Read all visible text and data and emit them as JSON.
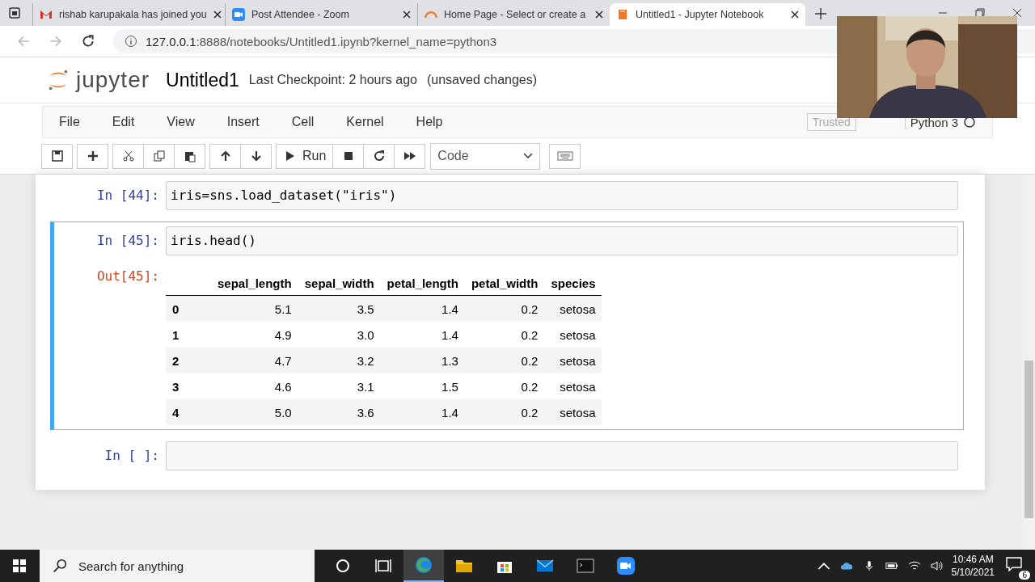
{
  "browser": {
    "tabs": [
      {
        "kind": "gmail",
        "title": "rishab karupakala has joined you",
        "selected": false
      },
      {
        "kind": "zoom",
        "title": "Post Attendee - Zoom",
        "selected": false
      },
      {
        "kind": "loader",
        "title": "Home Page - Select or create a",
        "selected": false
      },
      {
        "kind": "jupyter",
        "title": "Untitled1 - Jupyter Notebook",
        "selected": true
      }
    ],
    "url_host": "127.0.0.1",
    "url_rest": ":8888/notebooks/Untitled1.ipynb?kernel_name=python3"
  },
  "header": {
    "logo": "jupyter",
    "notebook_name": "Untitled1",
    "checkpoint": "Last Checkpoint: 2 hours ago",
    "status": "(unsaved changes)"
  },
  "menu": [
    "File",
    "Edit",
    "View",
    "Insert",
    "Cell",
    "Kernel",
    "Help"
  ],
  "trusted": "Trusted",
  "kernel": "Python 3",
  "toolbar": {
    "run_label": "Run",
    "cell_type": "Code"
  },
  "cells": [
    {
      "kind": "code",
      "prompt": "In [44]:",
      "source": "iris=sns.load_dataset(\"iris\")",
      "selected": false
    },
    {
      "kind": "code",
      "prompt": "In [45]:",
      "source": "iris.head()",
      "selected": true,
      "output": {
        "prompt": "Out[45]:",
        "columns": [
          "",
          "sepal_length",
          "sepal_width",
          "petal_length",
          "petal_width",
          "species"
        ],
        "rows": [
          [
            "0",
            "5.1",
            "3.5",
            "1.4",
            "0.2",
            "setosa"
          ],
          [
            "1",
            "4.9",
            "3.0",
            "1.4",
            "0.2",
            "setosa"
          ],
          [
            "2",
            "4.7",
            "3.2",
            "1.3",
            "0.2",
            "setosa"
          ],
          [
            "3",
            "4.6",
            "3.1",
            "1.5",
            "0.2",
            "setosa"
          ],
          [
            "4",
            "5.0",
            "3.6",
            "1.4",
            "0.2",
            "setosa"
          ]
        ]
      }
    },
    {
      "kind": "code",
      "prompt": "In [ ]:",
      "selected": false
    }
  ],
  "taskbar": {
    "search_placeholder": "Search for anything",
    "apps": [
      {
        "kind": "cortana",
        "selected": false
      },
      {
        "kind": "taskview",
        "selected": false
      },
      {
        "kind": "edge",
        "selected": true
      },
      {
        "kind": "explorer",
        "selected": false
      },
      {
        "kind": "store",
        "selected": false
      },
      {
        "kind": "mail",
        "selected": false
      },
      {
        "kind": "terminal",
        "selected": false
      },
      {
        "kind": "zoom",
        "selected": false
      }
    ],
    "time": "10:46 AM",
    "date": "5/10/2021",
    "notifications": "6"
  },
  "webcam": {
    "kind": "picture"
  }
}
